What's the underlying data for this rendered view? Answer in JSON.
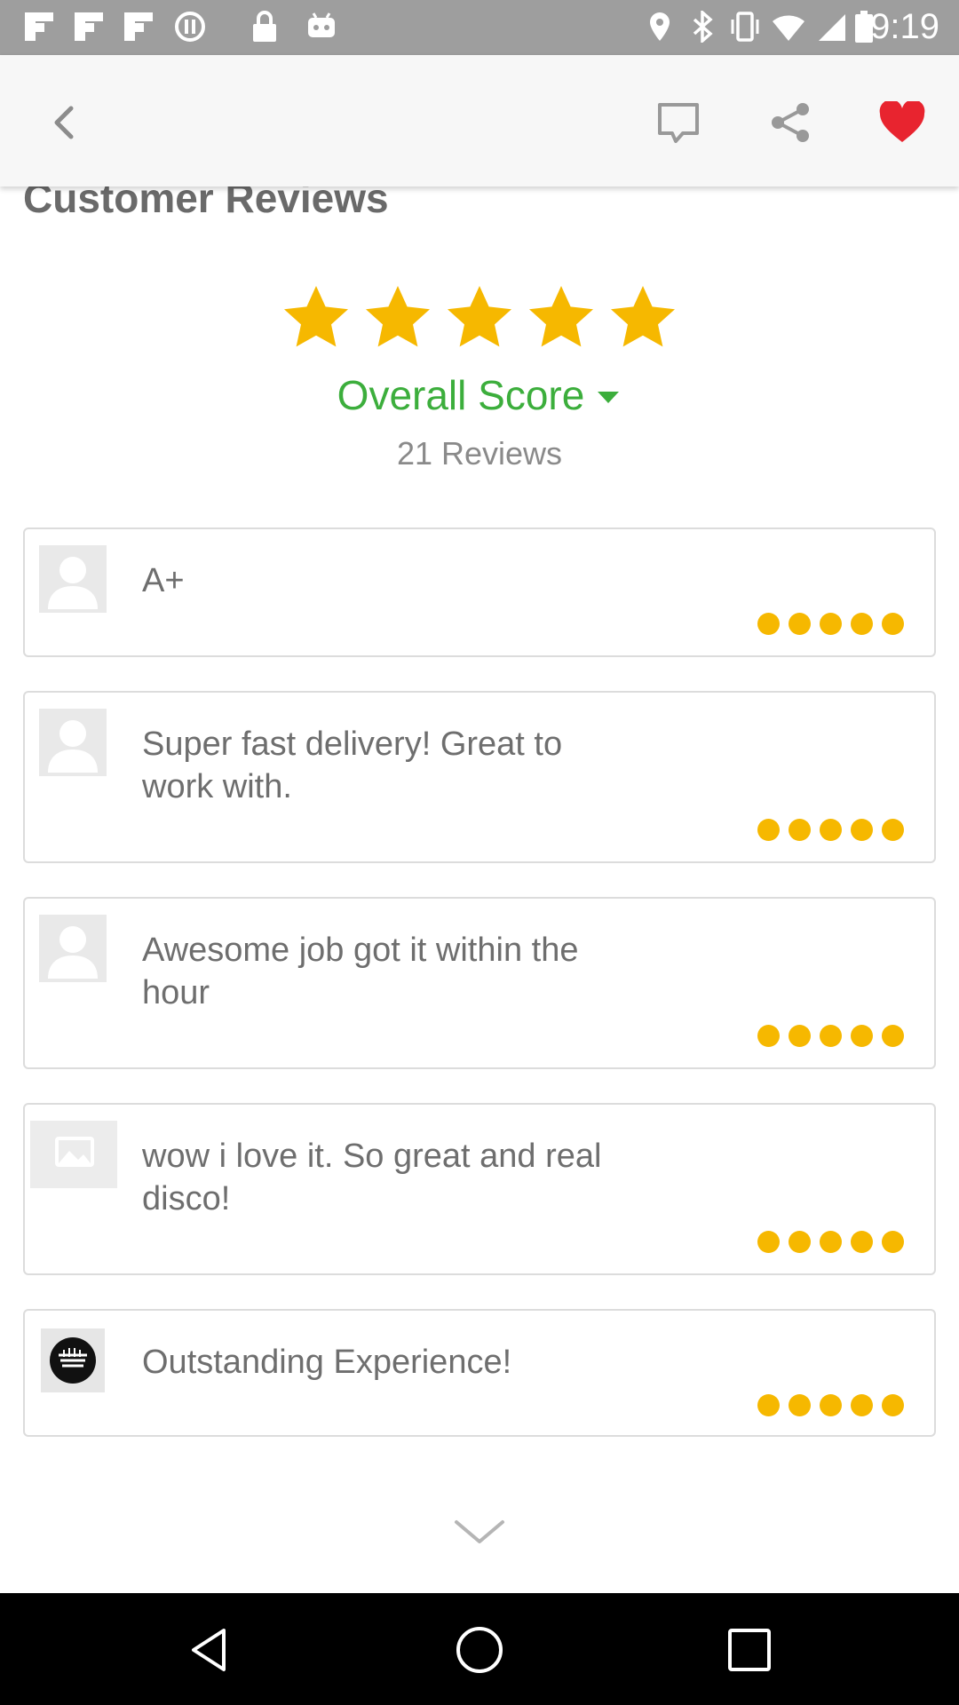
{
  "status_bar": {
    "time": "9:19"
  },
  "header": {
    "back_icon": "chevron-left-icon",
    "comment_icon": "comment-icon",
    "share_icon": "share-icon",
    "favorite_icon": "heart-icon",
    "favorite_color": "#e8242f"
  },
  "page": {
    "title": "Customer Reviews",
    "overall_rating": 5,
    "overall_label": "Overall Score",
    "review_count": "21 Reviews",
    "star_color": "#f6b800",
    "accent_color": "#3cae3c"
  },
  "reviews": [
    {
      "avatar": "default-user-avatar",
      "text": "A+",
      "rating": 5
    },
    {
      "avatar": "default-user-avatar",
      "text": "Super fast delivery!  Great to work with.",
      "rating": 5
    },
    {
      "avatar": "default-user-avatar",
      "text": "Awesome job got it within the hour",
      "rating": 5
    },
    {
      "avatar": "image-placeholder-avatar",
      "text": "wow i love it. So great and real disco!",
      "rating": 5
    },
    {
      "avatar": "logo-avatar",
      "text": "Outstanding Experience!",
      "rating": 5
    }
  ],
  "footer": {
    "expand_icon": "chevron-down-icon"
  },
  "nav_bar": {
    "back": "nav-back-icon",
    "home": "nav-home-icon",
    "recents": "nav-recents-icon"
  }
}
